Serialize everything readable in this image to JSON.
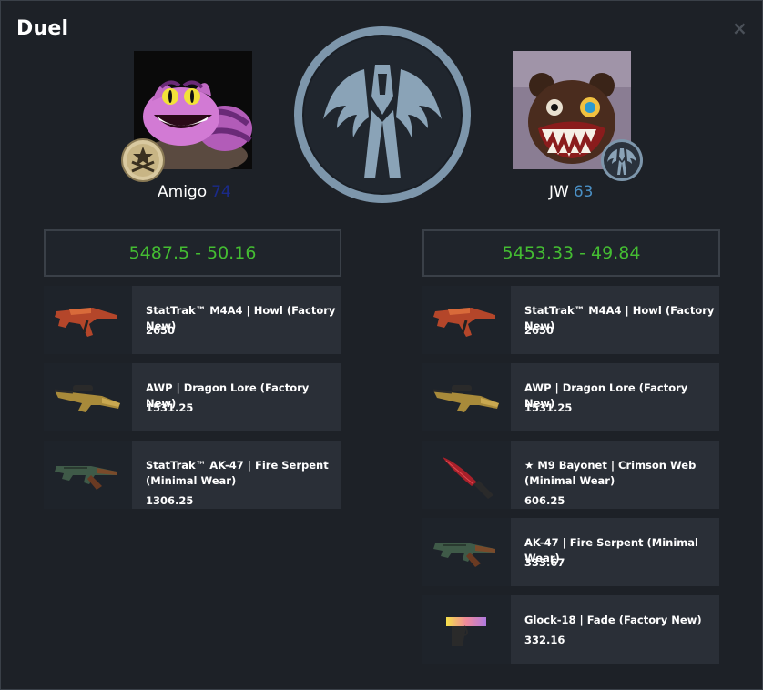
{
  "window": {
    "title": "Duel",
    "close_glyph": "×"
  },
  "colors": {
    "accent_green": "#44bd32",
    "level_left": "#1a2a8a",
    "level_right": "#4a8fc4",
    "panel": "#2a2f37",
    "background": "#1d2127"
  },
  "left_player": {
    "name": "Amigo",
    "level": "74",
    "avatar_icon": "cheshire-cat-avatar",
    "rank_icon": "rank-crossed-guns-badge",
    "total": "5487.5 - 50.16",
    "items": [
      {
        "name": "StatTrak™ M4A4 | Howl (Factory New)",
        "price": "2650",
        "icon": "m4a4-howl-icon"
      },
      {
        "name": "AWP | Dragon Lore (Factory New)",
        "price": "1531.25",
        "icon": "awp-dragon-lore-icon"
      },
      {
        "name": "StatTrak™ AK-47 | Fire Serpent (Minimal Wear)",
        "price": "1306.25",
        "icon": "ak47-fire-serpent-icon"
      }
    ]
  },
  "right_player": {
    "name": "JW",
    "level": "63",
    "avatar_icon": "monster-bear-avatar",
    "rank_icon": "ct-emblem-badge",
    "total": "5453.33 - 49.84",
    "items": [
      {
        "name": "StatTrak™ M4A4 | Howl (Factory New)",
        "price": "2650",
        "icon": "m4a4-howl-icon"
      },
      {
        "name": "AWP | Dragon Lore (Factory New)",
        "price": "1531.25",
        "icon": "awp-dragon-lore-icon"
      },
      {
        "name": "★ M9 Bayonet | Crimson Web (Minimal Wear)",
        "price": "606.25",
        "icon": "m9-bayonet-crimson-web-icon"
      },
      {
        "name": "AK-47 | Fire Serpent (Minimal Wear)",
        "price": "333.67",
        "icon": "ak47-fire-serpent-icon"
      },
      {
        "name": "Glock-18 | Fade (Factory New)",
        "price": "332.16",
        "icon": "glock-fade-icon"
      }
    ]
  },
  "center_emblem_icon": "counter-terrorist-emblem"
}
